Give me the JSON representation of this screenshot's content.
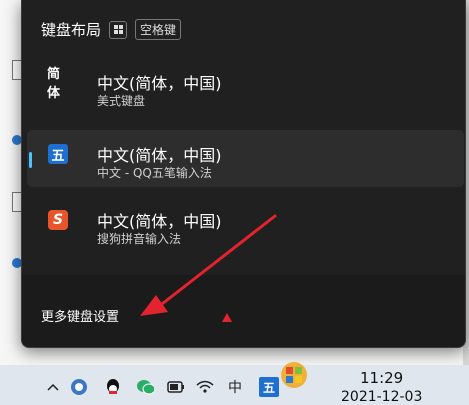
{
  "flyout": {
    "title": "键盘布局",
    "shortcut_space": "空格键",
    "items": [
      {
        "icon_text": "简体",
        "name": "中文(简体，中国)",
        "desc": "美式键盘",
        "icon": "jianti-text-icon"
      },
      {
        "icon_text": "五",
        "name": "中文(简体，中国)",
        "desc": "中文 - QQ五笔输入法",
        "icon": "qq-wubi-icon"
      },
      {
        "icon_text": "S",
        "name": "中文(简体，中国)",
        "desc": "搜狗拼音输入法",
        "icon": "sogou-icon"
      }
    ],
    "more_settings": "更多键盘设置"
  },
  "taskbar": {
    "ime_mode": "中",
    "ime_icon_text": "五",
    "time": "11:29",
    "date": "2021-12-03"
  },
  "colors": {
    "flyout_bg": "#202020",
    "accent": "#4cc2ff",
    "arrow": "#e3232e"
  }
}
